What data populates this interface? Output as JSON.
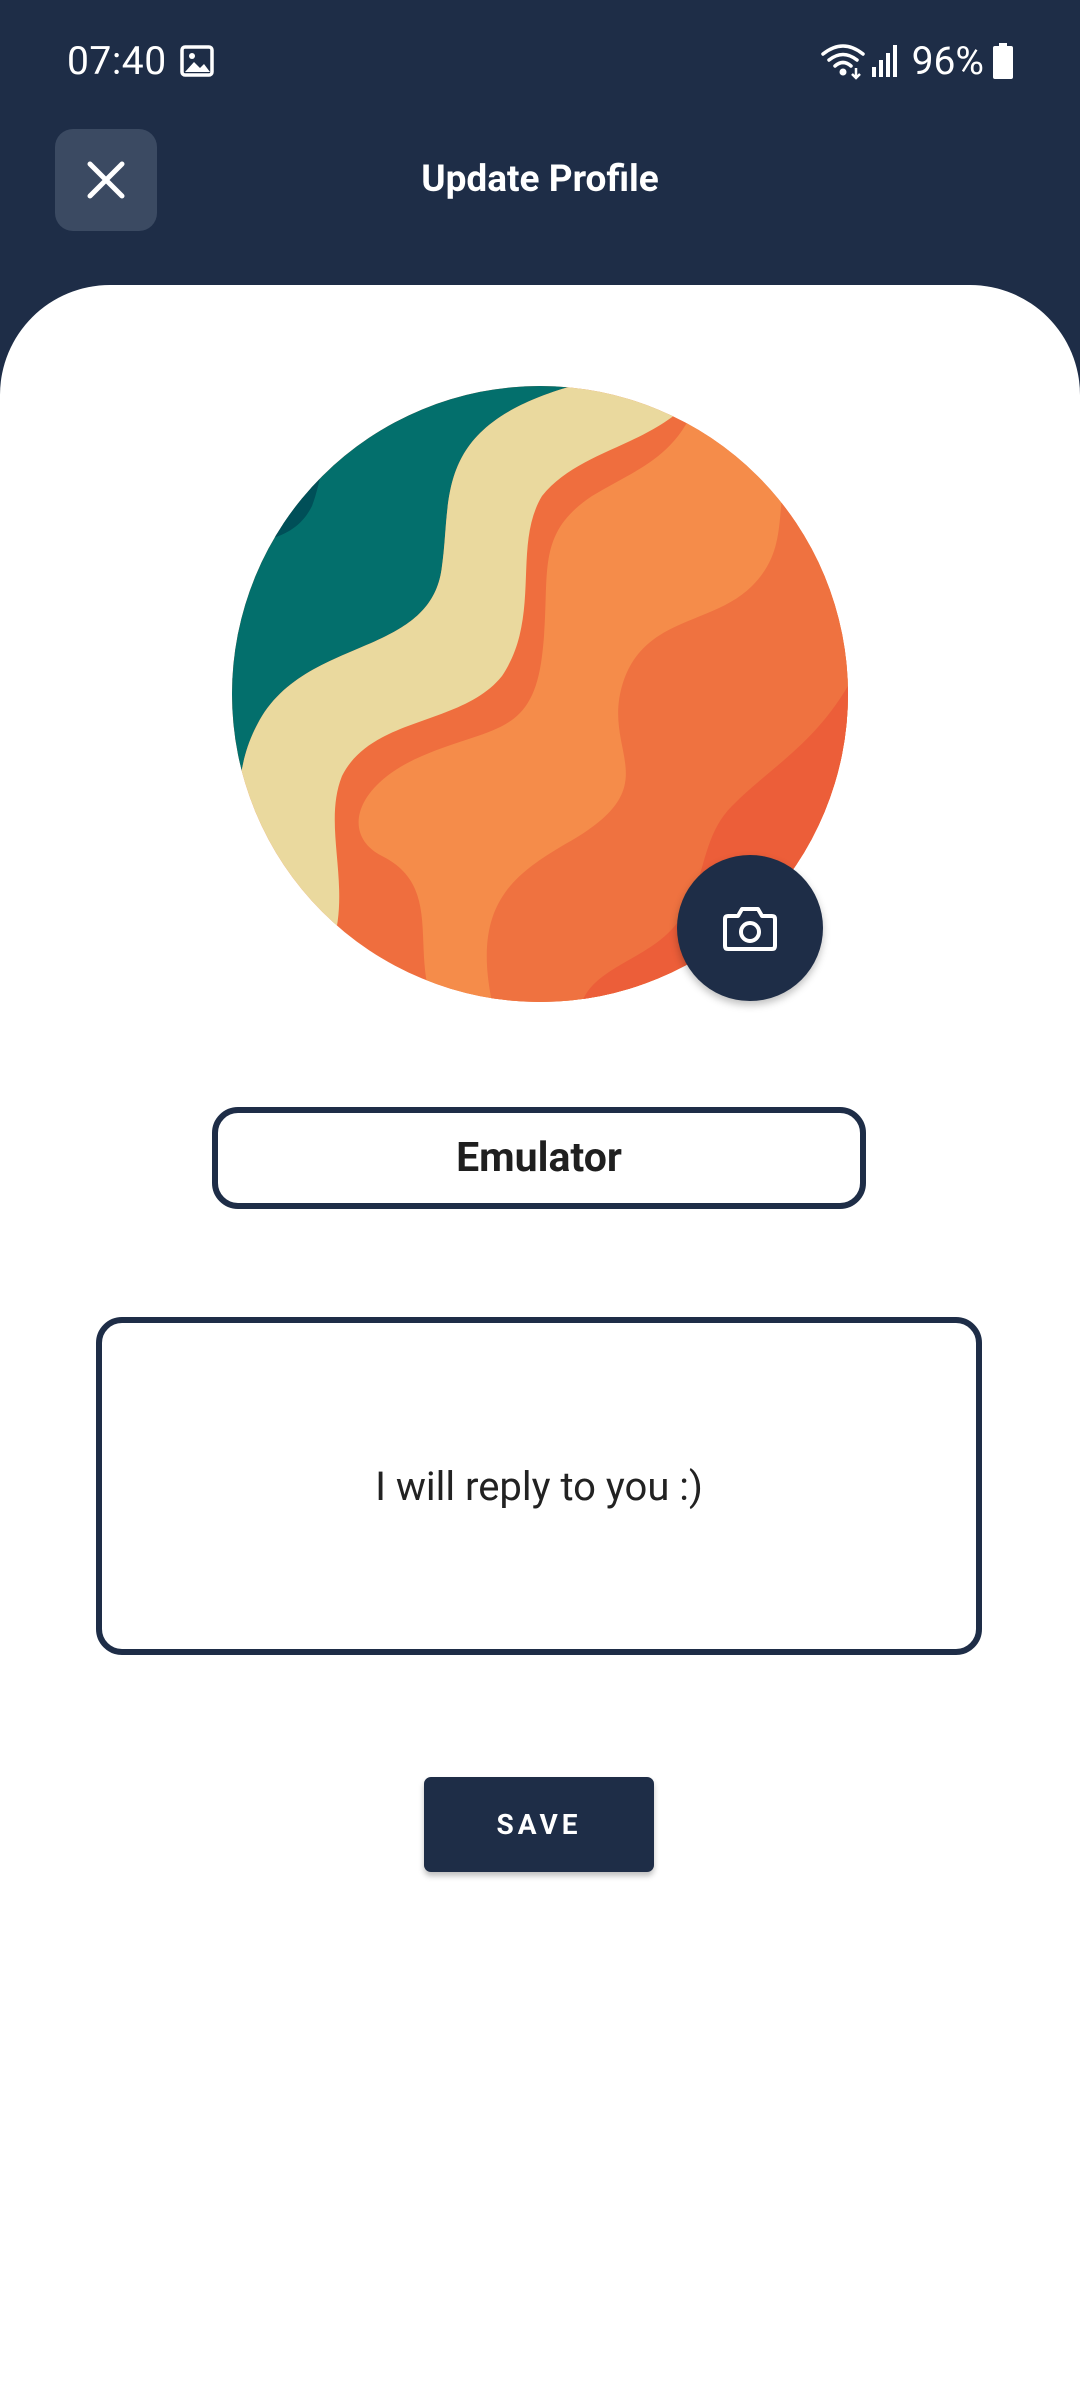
{
  "status_bar": {
    "time": "07:40",
    "battery_percent": "96%",
    "icons": [
      "gallery-icon",
      "wifi-icon",
      "signal-icon",
      "battery-icon"
    ]
  },
  "header": {
    "title": "Update Profile",
    "close_icon": "close-icon"
  },
  "profile": {
    "avatar_icon": "wave-pattern-avatar",
    "camera_icon": "camera-icon",
    "name": "Emulator",
    "bio": "I will reply to you :)"
  },
  "actions": {
    "save_label": "SAVE"
  },
  "colors": {
    "primary": "#1e2d47",
    "close_button_bg": "#3b4a62",
    "background": "#ffffff"
  }
}
